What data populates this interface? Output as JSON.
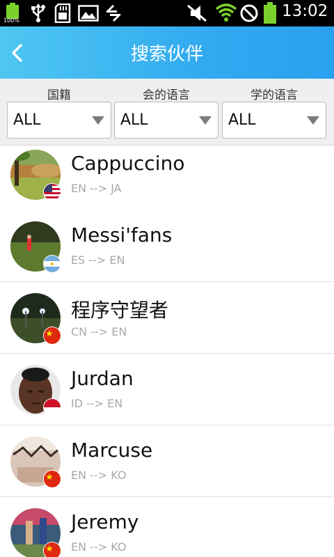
{
  "status_bar": {
    "battery_percent": "100%",
    "time": "13:02",
    "icons": [
      "battery-icon",
      "usb-icon",
      "sd-card-icon",
      "gallery-icon",
      "sync-icon",
      "mute-icon",
      "wifi-icon",
      "no-signal-icon",
      "battery-full-icon"
    ]
  },
  "header": {
    "title": "搜索伙伴",
    "back_icon": "chevron-left-icon"
  },
  "filters": [
    {
      "label": "国籍",
      "value": "ALL"
    },
    {
      "label": "会的语言",
      "value": "ALL"
    },
    {
      "label": "学的语言",
      "value": "ALL"
    }
  ],
  "partners": [
    {
      "name": "Cappuccino",
      "languages": "EN --> JA",
      "flag": "us-flag-icon"
    },
    {
      "name": "Messi'fans",
      "languages": "ES --> EN",
      "flag": "argentina-flag-icon"
    },
    {
      "name": "程序守望者",
      "languages": "CN --> EN",
      "flag": "china-flag-icon"
    },
    {
      "name": "Jurdan",
      "languages": "ID --> EN",
      "flag": "indonesia-flag-icon"
    },
    {
      "name": "Marcuse",
      "languages": "EN --> KO",
      "flag": "china-flag-icon"
    },
    {
      "name": "Jeremy",
      "languages": "EN --> KO",
      "flag": "china-flag-icon"
    }
  ],
  "colors": {
    "header_start": "#4ec7f2",
    "header_end": "#2aa0ef",
    "status_bar": "#000000",
    "battery_green": "#7bd12b",
    "wifi_green": "#7bd12b"
  }
}
